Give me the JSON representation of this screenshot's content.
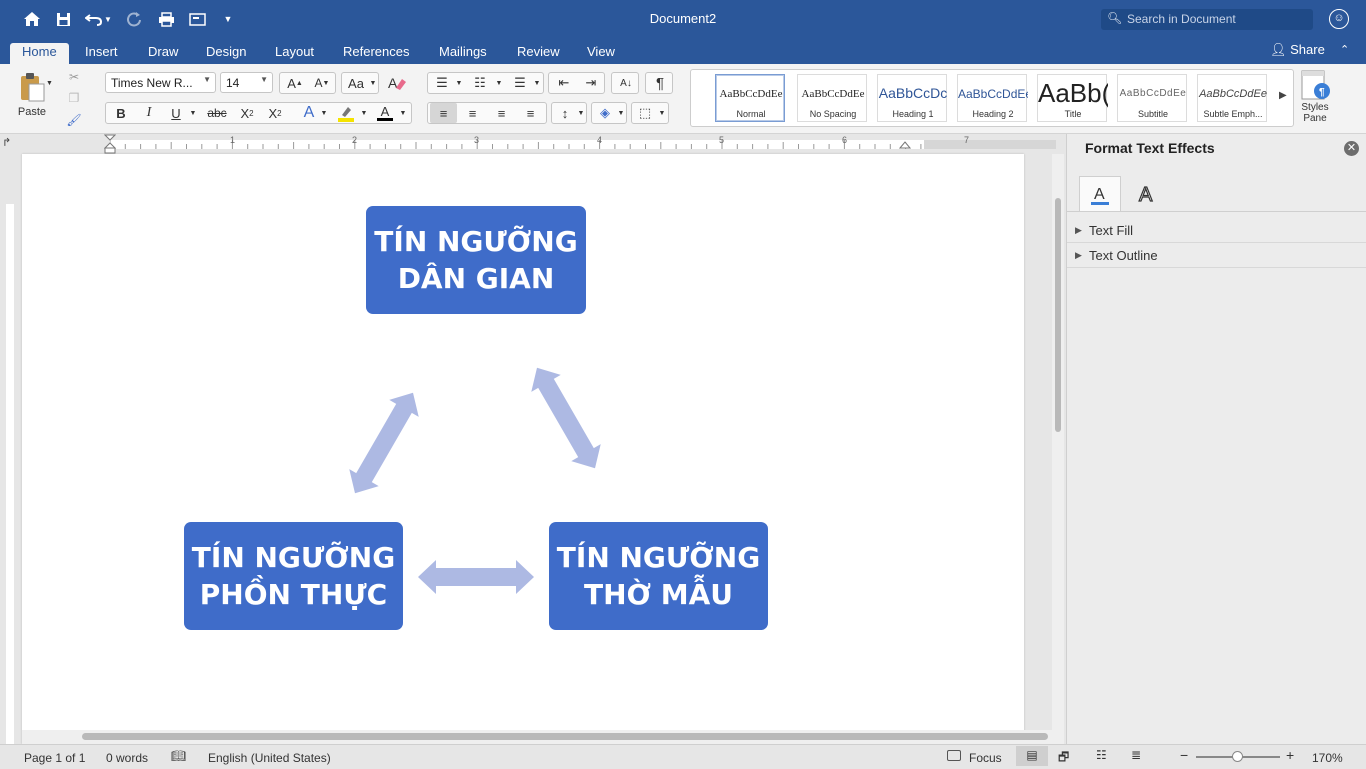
{
  "window": {
    "title": "Document2"
  },
  "titlebar": {
    "search_placeholder": "Search in Document"
  },
  "tabs": [
    {
      "label": "Home"
    },
    {
      "label": "Insert"
    },
    {
      "label": "Draw"
    },
    {
      "label": "Design"
    },
    {
      "label": "Layout"
    },
    {
      "label": "References"
    },
    {
      "label": "Mailings"
    },
    {
      "label": "Review"
    },
    {
      "label": "View"
    }
  ],
  "share": {
    "label": "Share"
  },
  "ribbon": {
    "paste_label": "Paste",
    "font_name": "Times New R...",
    "font_size": "14",
    "styles_pane_label": "Styles\nPane",
    "styles": [
      {
        "preview": "AaBbCcDdEe",
        "name": "Normal"
      },
      {
        "preview": "AaBbCcDdEe",
        "name": "No Spacing"
      },
      {
        "preview": "AaBbCcDc",
        "name": "Heading 1"
      },
      {
        "preview": "AaBbCcDdEe",
        "name": "Heading 2"
      },
      {
        "preview": "AaBb(",
        "name": "Title"
      },
      {
        "preview": "AaBbCcDdEe",
        "name": "Subtitle"
      },
      {
        "preview": "AaBbCcDdEe",
        "name": "Subtle Emph..."
      }
    ],
    "colors": {
      "highlight": "#f5e300",
      "font_color": "#000000"
    }
  },
  "ruler": {
    "numbers": [
      "1",
      "2",
      "3",
      "4",
      "5",
      "6",
      "7"
    ]
  },
  "document": {
    "smartart": {
      "top": {
        "line1": "TÍN NGƯỠNG",
        "line2": "DÂN GIAN"
      },
      "left": {
        "line1": "TÍN NGƯỠNG",
        "line2": "PHỒN THỰC"
      },
      "right": {
        "line1": "TÍN NGƯỠNG",
        "line2": "THỜ MẪU"
      },
      "box_color": "#3f6cc9",
      "arrow_color": "#adb9e3"
    }
  },
  "pane": {
    "title": "Format Text Effects",
    "sections": [
      {
        "label": "Text Fill"
      },
      {
        "label": "Text Outline"
      }
    ]
  },
  "status": {
    "page": "Page 1 of 1",
    "words": "0 words",
    "language": "English (United States)",
    "focus": "Focus",
    "zoom": "170%"
  }
}
